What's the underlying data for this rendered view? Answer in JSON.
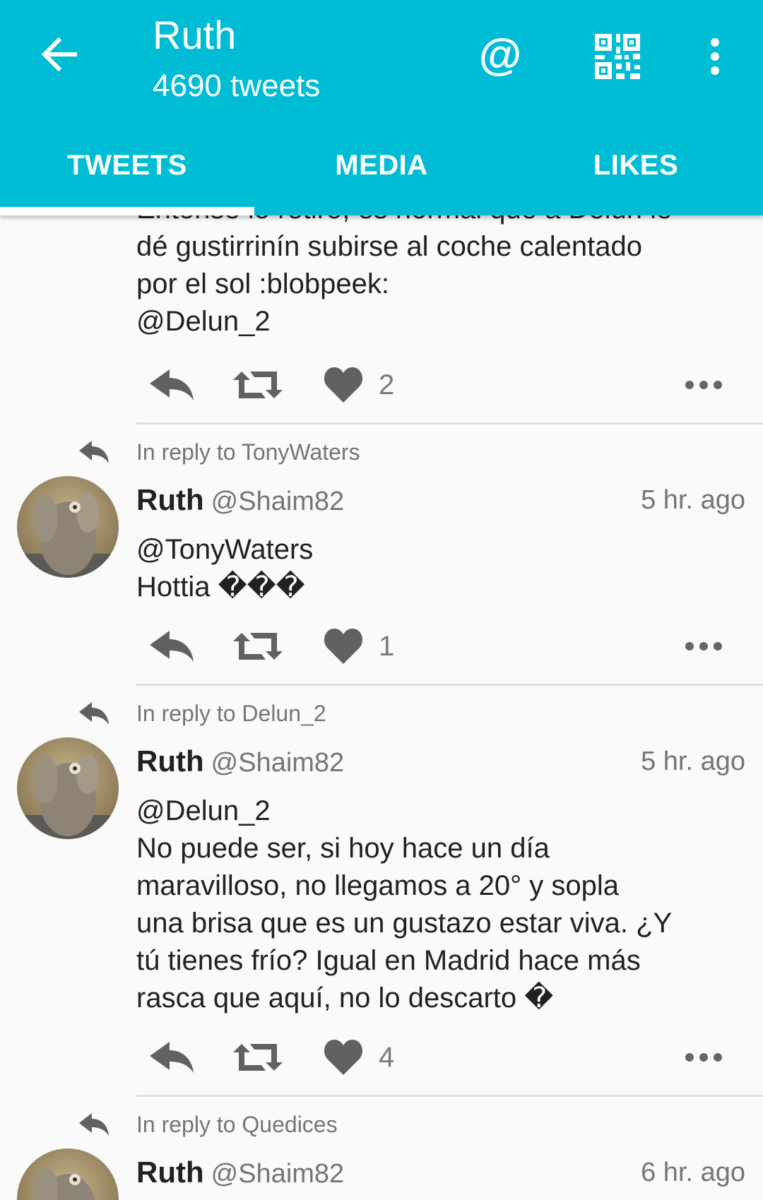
{
  "app_bar": {
    "title": "Ruth",
    "subtitle": "4690 tweets",
    "icons": [
      "back-arrow-icon",
      "at-icon",
      "qr-code-icon",
      "overflow-menu-icon"
    ],
    "at_symbol": "@",
    "background_color": "#00bcd4"
  },
  "tabs": [
    {
      "label": "TWEETS",
      "selected": true
    },
    {
      "label": "MEDIA",
      "selected": false
    },
    {
      "label": "LIKES",
      "selected": false
    }
  ],
  "tweets": [
    {
      "partial": true,
      "lines": [
        "Entonse lo retiro, es normal que a Delun le",
        "dé gustirrinín subirse al coche calentado",
        "por el sol :blobpeek:",
        "@Delun_2"
      ],
      "likes": "2"
    },
    {
      "reply_to": "In reply to TonyWaters",
      "name": "Ruth",
      "handle": "@Shaim82",
      "time": "5 hr. ago",
      "lines": [
        "@TonyWaters",
        "Hottia ���"
      ],
      "likes": "1"
    },
    {
      "reply_to": "In reply to Delun_2",
      "name": "Ruth",
      "handle": "@Shaim82",
      "time": "5 hr. ago",
      "lines": [
        "@Delun_2",
        "No puede ser, si hoy hace un día",
        "maravilloso, no llegamos a 20° y sopla",
        "una brisa que es un gustazo estar viva. ¿Y",
        "tú tienes frío? Igual en Madrid hace más",
        "rasca que aquí, no lo descarto �"
      ],
      "likes": "4"
    },
    {
      "reply_to": "In reply to Quedices",
      "name": "Ruth",
      "handle": "@Shaim82",
      "time": "6 hr. ago"
    }
  ]
}
